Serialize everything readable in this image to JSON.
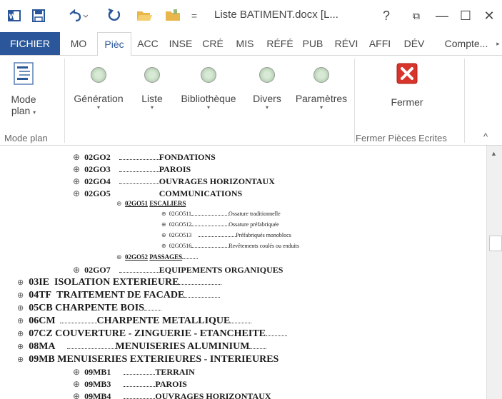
{
  "window": {
    "title": "Liste BATIMENT.docx [L...",
    "help": "?",
    "ribbon_display": "⧉",
    "minimize": "—",
    "maximize": "☐",
    "close": "✕"
  },
  "quick_access": {
    "app_icon": "word-icon",
    "save_icon": "save-icon",
    "undo_icon": "undo-icon",
    "redo_icon": "redo-icon",
    "open_icon": "folder-open-icon",
    "new_icon": "folder-icon",
    "customize": "="
  },
  "tabs": [
    {
      "label": "FICHIER"
    },
    {
      "label": "MO"
    },
    {
      "label": "Pièc"
    },
    {
      "label": "ACC"
    },
    {
      "label": "INSE"
    },
    {
      "label": "CRÉ"
    },
    {
      "label": "MIS"
    },
    {
      "label": "RÉFÉ"
    },
    {
      "label": "PUB"
    },
    {
      "label": "RÉVI"
    },
    {
      "label": "AFFI"
    },
    {
      "label": "DÉV"
    },
    {
      "label": "Compte..."
    }
  ],
  "ribbon": {
    "mode_plan": {
      "line1": "Mode",
      "line2": "plan"
    },
    "generation": "Génération",
    "liste": "Liste",
    "bibliotheque": "Bibliothèque",
    "divers": "Divers",
    "parametres": "Paramètres",
    "fermer": "Fermer",
    "group_mode_plan": "Mode plan",
    "group_fermer": "Fermer Pièces Ecrites",
    "collapse": "^"
  },
  "document": {
    "rows": [
      {
        "code": "02GO2",
        "label": "FONDATIONS"
      },
      {
        "code": "02GO3",
        "label": "PAROIS"
      },
      {
        "code": "02GO4",
        "label": "OUVRAGES HORIZONTAUX"
      },
      {
        "code": "02GO5",
        "label": "COMMUNICATIONS"
      },
      {
        "code": "02GO51",
        "label": "ESCALIERS"
      },
      {
        "code": "02GO511",
        "label": "Ossature traditionnelle"
      },
      {
        "code": "02GO512",
        "label": "Ossature préfabriquée"
      },
      {
        "code": "02GO513",
        "label": "Préfabriqués monoblocs"
      },
      {
        "code": "02GO516",
        "label": "Revêtements coulés ou enduits"
      },
      {
        "code": "02GO52",
        "label": "PASSAGES"
      },
      {
        "code": "02GO7",
        "label": "EQUIPEMENTS ORGANIQUES"
      },
      {
        "code": "03IE",
        "label": "ISOLATION EXTERIEURE"
      },
      {
        "code": "04TF",
        "label": "TRAITEMENT DE FACADE"
      },
      {
        "code": "05CB",
        "label": "CHARPENTE BOIS"
      },
      {
        "code": "06CM",
        "label": "CHARPENTE METALLIQUE"
      },
      {
        "code": "07CZ",
        "label": "COUVERTURE - ZINGUERIE - ETANCHEITE"
      },
      {
        "code": "08MA",
        "label": "MENUISERIES ALUMINIUM"
      },
      {
        "code": "09MB",
        "label": "MENUISERIES EXTERIEURES - INTERIEURES"
      },
      {
        "code": "09MB1",
        "label": "TERRAIN"
      },
      {
        "code": "09MB3",
        "label": "PAROIS"
      },
      {
        "code": "09MB4",
        "label": "OUVRAGES HORIZONTAUX"
      }
    ]
  },
  "colors": {
    "file_tab": "#2b579a",
    "close_red": "#d9342b"
  }
}
